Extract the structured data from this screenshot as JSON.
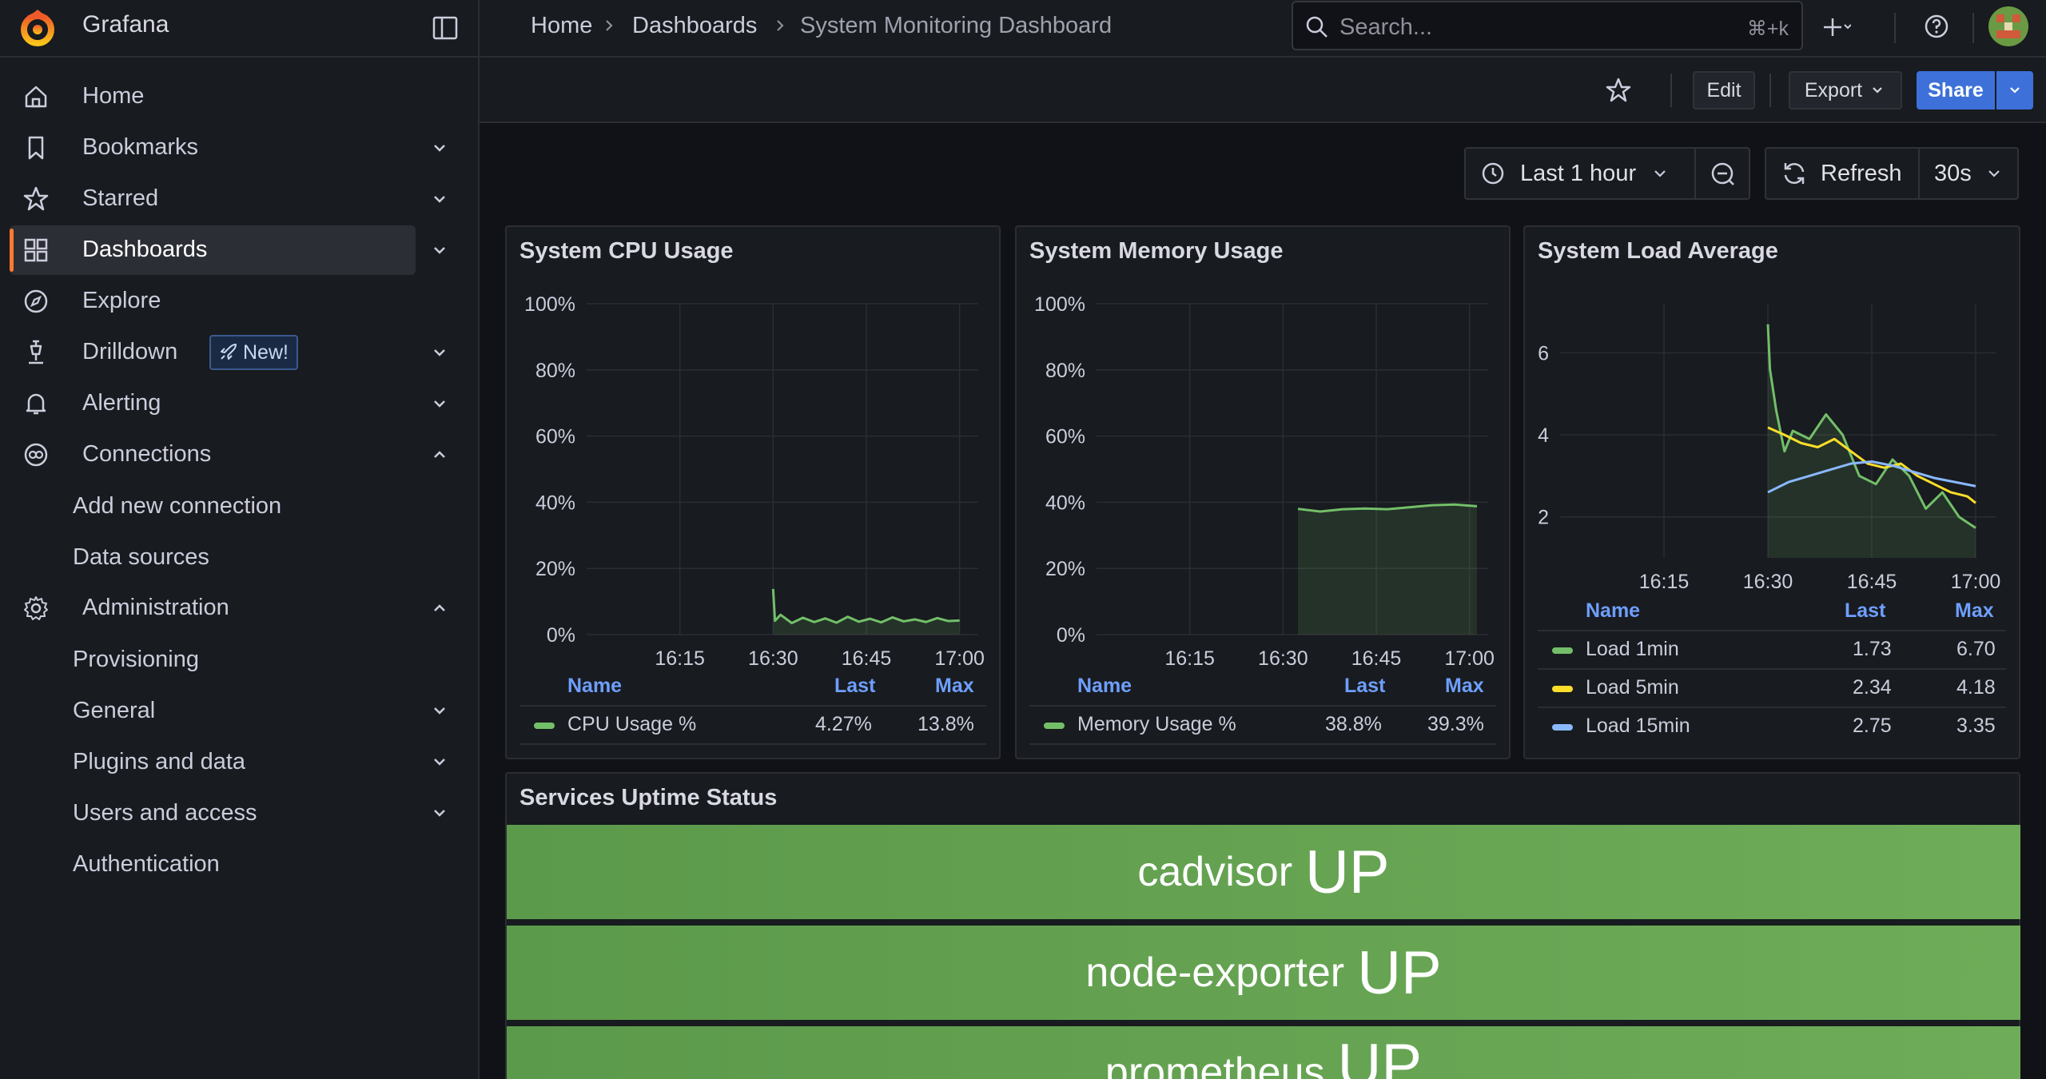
{
  "brand": "Grafana",
  "nav": {
    "home": "Home",
    "bookmarks": "Bookmarks",
    "starred": "Starred",
    "dashboards": "Dashboards",
    "explore": "Explore",
    "drilldown": "Drilldown",
    "drilldown_badge": "New!",
    "alerting": "Alerting",
    "connections": "Connections",
    "add_new_connection": "Add new connection",
    "data_sources": "Data sources",
    "administration": "Administration",
    "provisioning": "Provisioning",
    "general": "General",
    "plugins_and_data": "Plugins and data",
    "users_and_access": "Users and access",
    "authentication": "Authentication"
  },
  "breadcrumb": [
    "Home",
    "Dashboards",
    "System Monitoring Dashboard"
  ],
  "search": {
    "placeholder": "Search...",
    "shortcut": "⌘+k"
  },
  "toolbar": {
    "edit": "Edit",
    "export": "Export",
    "share": "Share"
  },
  "time": {
    "range": "Last 1 hour",
    "refresh": "Refresh",
    "interval": "30s"
  },
  "colors": {
    "accent": "#ff7a2f",
    "primary": "#3d71d9",
    "series_green": "#73bf69",
    "series_yellow": "#fade2a",
    "series_blue": "#8ab8ff",
    "up_green": "#629e51"
  },
  "panels": {
    "cpu": {
      "title": "System CPU Usage",
      "legend_head": [
        "Name",
        "Last",
        "Max"
      ],
      "legend": [
        {
          "name": "CPU Usage %",
          "last": "4.27%",
          "max": "13.8%"
        }
      ]
    },
    "memory": {
      "title": "System Memory Usage",
      "legend_head": [
        "Name",
        "Last",
        "Max"
      ],
      "legend": [
        {
          "name": "Memory Usage %",
          "last": "38.8%",
          "max": "39.3%"
        }
      ]
    },
    "load": {
      "title": "System Load Average",
      "legend_head": [
        "Name",
        "Last",
        "Max"
      ],
      "legend": [
        {
          "name": "Load 1min",
          "last": "1.73",
          "max": "6.70"
        },
        {
          "name": "Load 5min",
          "last": "2.34",
          "max": "4.18"
        },
        {
          "name": "Load 15min",
          "last": "2.75",
          "max": "3.35"
        }
      ]
    },
    "uptime": {
      "title": "Services Uptime Status",
      "services": [
        {
          "name": "cadvisor",
          "status": "UP"
        },
        {
          "name": "node-exporter",
          "status": "UP"
        },
        {
          "name": "prometheus",
          "status": "UP"
        }
      ]
    }
  },
  "chart_data": [
    {
      "type": "line",
      "title": "System CPU Usage",
      "x_ticks": [
        "16:15",
        "16:30",
        "16:45",
        "17:00"
      ],
      "y_ticks": [
        "0%",
        "20%",
        "40%",
        "60%",
        "80%",
        "100%"
      ],
      "ylim": [
        0,
        100
      ],
      "x_range_minutes": [
        16.0,
        17.05
      ],
      "series": [
        {
          "name": "CPU Usage %",
          "color": "#73bf69",
          "x": [
            16.5,
            16.505,
            16.52,
            16.55,
            16.58,
            16.61,
            16.64,
            16.67,
            16.7,
            16.73,
            16.76,
            16.79,
            16.82,
            16.85,
            16.88,
            16.91,
            16.94,
            16.97,
            17.0
          ],
          "values": [
            13.8,
            4.2,
            6.0,
            3.5,
            5.1,
            3.8,
            4.9,
            3.6,
            5.4,
            3.9,
            4.8,
            3.7,
            5.2,
            4.0,
            4.6,
            3.8,
            5.0,
            4.1,
            4.27
          ]
        }
      ],
      "grid": true
    },
    {
      "type": "area",
      "title": "System Memory Usage",
      "x_ticks": [
        "16:15",
        "16:30",
        "16:45",
        "17:00"
      ],
      "y_ticks": [
        "0%",
        "20%",
        "40%",
        "60%",
        "80%",
        "100%"
      ],
      "ylim": [
        0,
        100
      ],
      "series": [
        {
          "name": "Memory Usage %",
          "color": "#73bf69",
          "x": [
            16.54,
            16.6,
            16.66,
            16.72,
            16.78,
            16.84,
            16.9,
            16.96,
            17.02
          ],
          "values": [
            38.0,
            37.2,
            37.9,
            38.1,
            37.9,
            38.5,
            39.1,
            39.3,
            38.8
          ]
        }
      ],
      "grid": true
    },
    {
      "type": "area",
      "title": "System Load Average",
      "x_ticks": [
        "16:15",
        "16:30",
        "16:45",
        "17:00"
      ],
      "y_ticks": [
        "2",
        "4",
        "6"
      ],
      "ylim": [
        1,
        7.2
      ],
      "series": [
        {
          "name": "Load 1min",
          "color": "#73bf69",
          "x": [
            16.5,
            16.505,
            16.52,
            16.54,
            16.56,
            16.6,
            16.64,
            16.68,
            16.72,
            16.76,
            16.8,
            16.84,
            16.88,
            16.92,
            16.96,
            17.0
          ],
          "values": [
            6.7,
            5.6,
            4.6,
            3.6,
            4.1,
            3.9,
            4.5,
            4.0,
            3.0,
            2.8,
            3.4,
            3.0,
            2.2,
            2.6,
            2.0,
            1.73
          ]
        },
        {
          "name": "Load 5min",
          "color": "#fade2a",
          "x": [
            16.5,
            16.54,
            16.58,
            16.62,
            16.66,
            16.7,
            16.74,
            16.78,
            16.82,
            16.86,
            16.9,
            16.94,
            16.98,
            17.0
          ],
          "values": [
            4.18,
            4.0,
            3.8,
            3.7,
            3.9,
            3.6,
            3.3,
            3.2,
            3.3,
            3.0,
            2.8,
            2.6,
            2.5,
            2.34
          ]
        },
        {
          "name": "Load 15min",
          "color": "#8ab8ff",
          "x": [
            16.5,
            16.55,
            16.6,
            16.65,
            16.7,
            16.75,
            16.8,
            16.85,
            16.9,
            16.95,
            17.0
          ],
          "values": [
            2.6,
            2.85,
            3.0,
            3.15,
            3.3,
            3.35,
            3.25,
            3.1,
            2.95,
            2.85,
            2.75
          ]
        }
      ],
      "grid": true
    }
  ]
}
